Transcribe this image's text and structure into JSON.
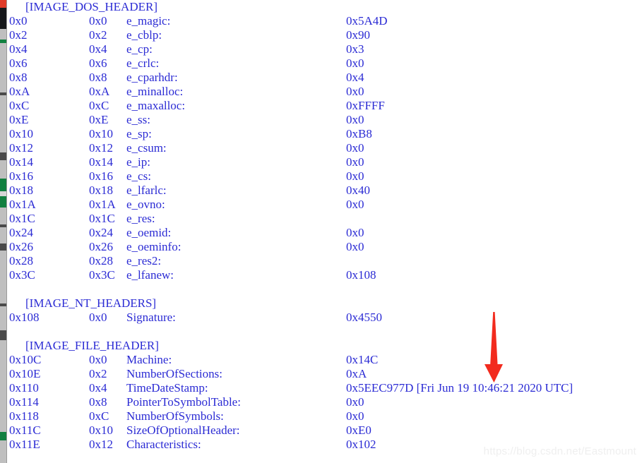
{
  "colors": {
    "text_blue": "#2b2bd4",
    "background": "#ffffff",
    "arrow_red": "#f22b1e",
    "watermark_gray": "#efefef",
    "gutter_gray": "#bfbfbf",
    "gutter_green": "#118040",
    "gutter_red": "#e03b28",
    "gutter_black": "#15171a"
  },
  "watermark": {
    "text": "https://blog.csdn.net/Eastmount"
  },
  "annotation": {
    "arrow_name": "down-arrow-annotation",
    "points_at": "TimeDateStamp"
  },
  "dump": {
    "lines": [
      {
        "kind": "section",
        "section": "[IMAGE_DOS_HEADER]"
      },
      {
        "kind": "field",
        "raw": "0x0",
        "rva": "0x0",
        "name": "e_magic:",
        "value": "0x5A4D"
      },
      {
        "kind": "field",
        "raw": "0x2",
        "rva": "0x2",
        "name": "e_cblp:",
        "value": "0x90"
      },
      {
        "kind": "field",
        "raw": "0x4",
        "rva": "0x4",
        "name": "e_cp:",
        "value": "0x3"
      },
      {
        "kind": "field",
        "raw": "0x6",
        "rva": "0x6",
        "name": "e_crlc:",
        "value": "0x0"
      },
      {
        "kind": "field",
        "raw": "0x8",
        "rva": "0x8",
        "name": "e_cparhdr:",
        "value": "0x4"
      },
      {
        "kind": "field",
        "raw": "0xA",
        "rva": "0xA",
        "name": "e_minalloc:",
        "value": "0x0"
      },
      {
        "kind": "field",
        "raw": "0xC",
        "rva": "0xC",
        "name": "e_maxalloc:",
        "value": "0xFFFF"
      },
      {
        "kind": "field",
        "raw": "0xE",
        "rva": "0xE",
        "name": "e_ss:",
        "value": "0x0"
      },
      {
        "kind": "field",
        "raw": "0x10",
        "rva": "0x10",
        "name": "e_sp:",
        "value": "0xB8"
      },
      {
        "kind": "field",
        "raw": "0x12",
        "rva": "0x12",
        "name": "e_csum:",
        "value": "0x0"
      },
      {
        "kind": "field",
        "raw": "0x14",
        "rva": "0x14",
        "name": "e_ip:",
        "value": "0x0"
      },
      {
        "kind": "field",
        "raw": "0x16",
        "rva": "0x16",
        "name": "e_cs:",
        "value": "0x0"
      },
      {
        "kind": "field",
        "raw": "0x18",
        "rva": "0x18",
        "name": "e_lfarlc:",
        "value": "0x40"
      },
      {
        "kind": "field",
        "raw": "0x1A",
        "rva": "0x1A",
        "name": "e_ovno:",
        "value": "0x0"
      },
      {
        "kind": "field",
        "raw": "0x1C",
        "rva": "0x1C",
        "name": "e_res:",
        "value": ""
      },
      {
        "kind": "field",
        "raw": "0x24",
        "rva": "0x24",
        "name": "e_oemid:",
        "value": "0x0"
      },
      {
        "kind": "field",
        "raw": "0x26",
        "rva": "0x26",
        "name": "e_oeminfo:",
        "value": "0x0"
      },
      {
        "kind": "field",
        "raw": "0x28",
        "rva": "0x28",
        "name": "e_res2:",
        "value": ""
      },
      {
        "kind": "field",
        "raw": "0x3C",
        "rva": "0x3C",
        "name": "e_lfanew:",
        "value": "0x108"
      },
      {
        "kind": "blank"
      },
      {
        "kind": "section",
        "section": "[IMAGE_NT_HEADERS]"
      },
      {
        "kind": "field",
        "raw": "0x108",
        "rva": "0x0",
        "name": "Signature:",
        "value": "0x4550"
      },
      {
        "kind": "blank"
      },
      {
        "kind": "section",
        "section": "[IMAGE_FILE_HEADER]"
      },
      {
        "kind": "field",
        "raw": "0x10C",
        "rva": "0x0",
        "name": "Machine:",
        "value": "0x14C"
      },
      {
        "kind": "field",
        "raw": "0x10E",
        "rva": "0x2",
        "name": "NumberOfSections:",
        "value": "0xA"
      },
      {
        "kind": "field",
        "raw": "0x110",
        "rva": "0x4",
        "name": "TimeDateStamp:",
        "value": "0x5EEC977D [Fri Jun 19 10:46:21 2020 UTC]"
      },
      {
        "kind": "field",
        "raw": "0x114",
        "rva": "0x8",
        "name": "PointerToSymbolTable:",
        "value": "0x0"
      },
      {
        "kind": "field",
        "raw": "0x118",
        "rva": "0xC",
        "name": "NumberOfSymbols:",
        "value": "0x0"
      },
      {
        "kind": "field",
        "raw": "0x11C",
        "rva": "0x10",
        "name": "SizeOfOptionalHeader:",
        "value": "0xE0"
      },
      {
        "kind": "field",
        "raw": "0x11E",
        "rva": "0x12",
        "name": "Characteristics:",
        "value": "0x102"
      }
    ]
  }
}
